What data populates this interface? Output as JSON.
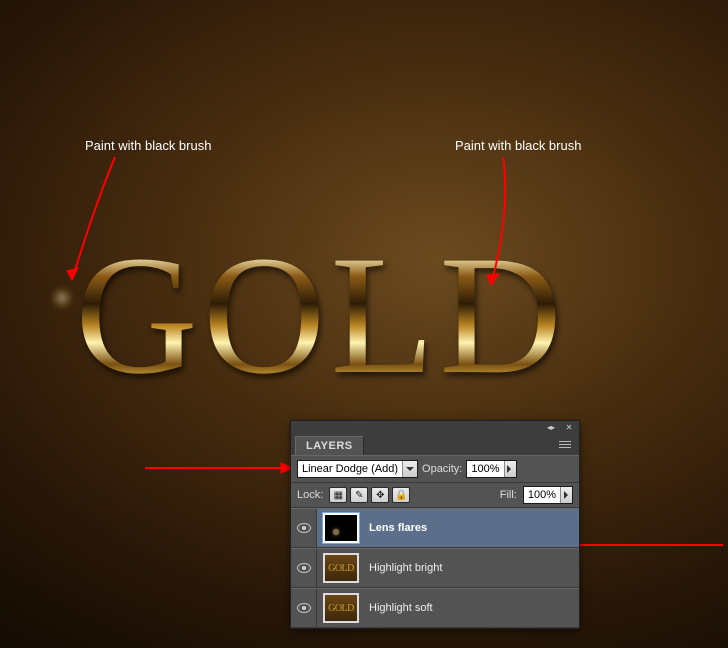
{
  "annotations": {
    "left_label": "Paint with black brush",
    "right_label": "Paint with black brush"
  },
  "artwork": {
    "text": "GOLD"
  },
  "panel": {
    "title": "LAYERS",
    "blend_mode": "Linear Dodge (Add)",
    "opacity_label": "Opacity:",
    "opacity_value": "100%",
    "lock_label": "Lock:",
    "fill_label": "Fill:",
    "fill_value": "100%",
    "layers": [
      {
        "name": "Lens flares",
        "selected": true,
        "thumb": "black-flare"
      },
      {
        "name": "Highlight bright",
        "selected": false,
        "thumb": "brown"
      },
      {
        "name": "Highlight soft",
        "selected": false,
        "thumb": "brown"
      }
    ]
  }
}
